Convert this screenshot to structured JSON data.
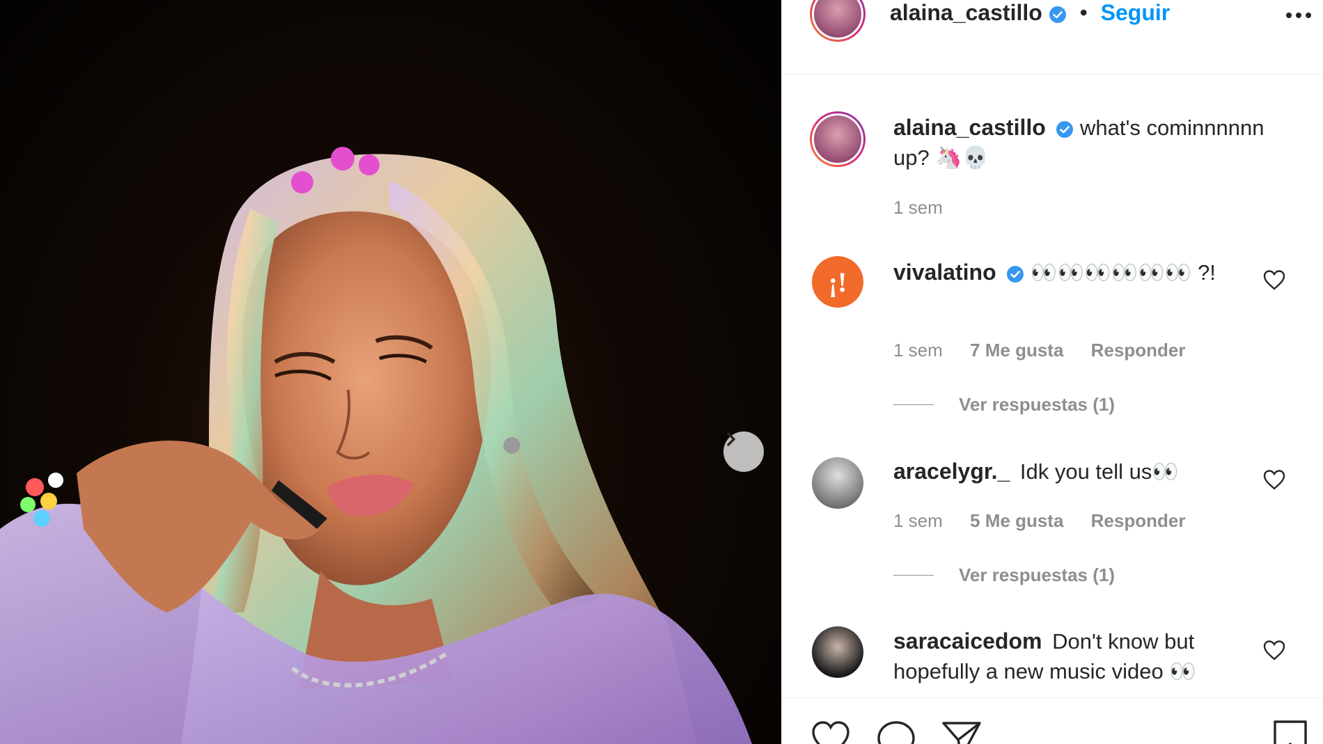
{
  "post": {
    "author": "alaina_castillo",
    "follow_label": "Seguir",
    "separator": "•",
    "caption": {
      "username": "alaina_castillo",
      "text": "what's cominnnnnn up? 🦄💀",
      "time": "1 sem"
    },
    "media": {
      "next_icon": "chevron-right-icon",
      "description_colors": {
        "bg": "#0a0604",
        "hair": "#cdb5e8",
        "jacket": "#c4a4e8",
        "beads": "#e44fcf"
      }
    }
  },
  "comments": [
    {
      "username": "vivalatino",
      "verified": true,
      "text": "👀👀👀👀👀👀 ?!",
      "time": "1 sem",
      "likes": "7 Me gusta",
      "reply_label": "Responder",
      "view_replies": "Ver respuestas (1)"
    },
    {
      "username": "aracelygr._",
      "verified": false,
      "text": "Idk you tell us👀",
      "time": "1 sem",
      "likes": "5 Me gusta",
      "reply_label": "Responder",
      "view_replies": "Ver respuestas (1)"
    },
    {
      "username": "saracaicedom",
      "verified": false,
      "text": "Don't know but hopefully a new music video 👀"
    }
  ],
  "colors": {
    "accent": "#0095f6",
    "verified": "#3897f0",
    "muted": "#8e8e8e",
    "text": "#262626"
  }
}
